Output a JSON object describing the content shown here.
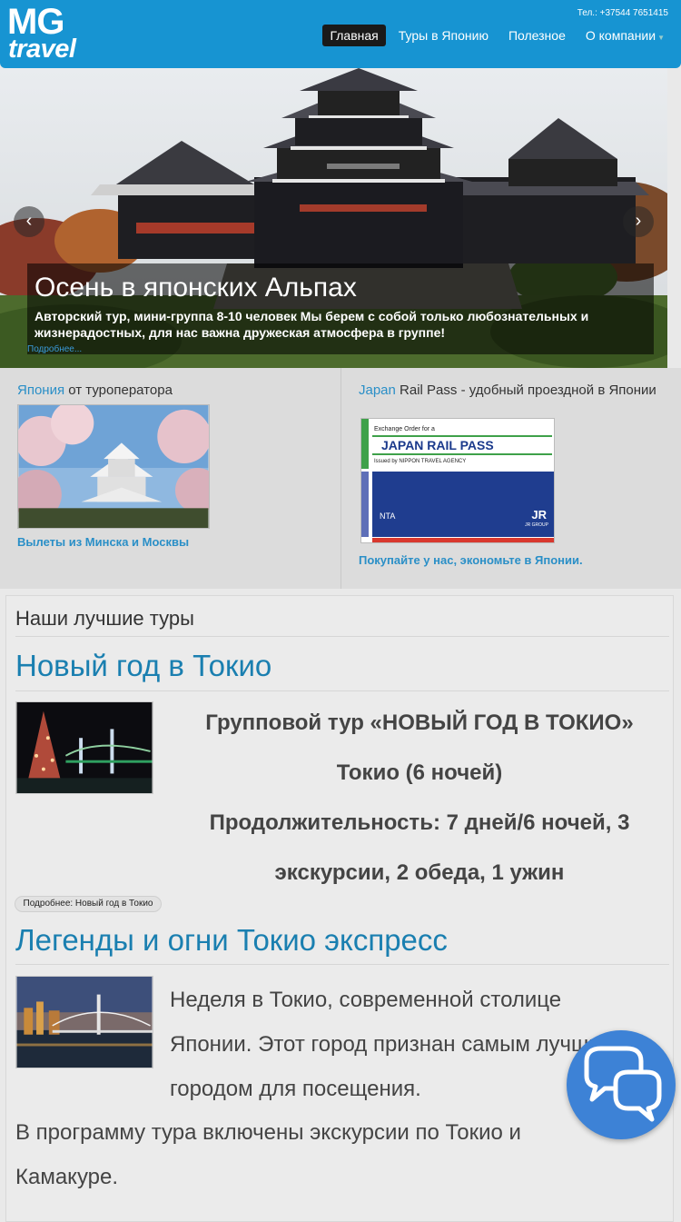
{
  "header": {
    "logo_top": "MG",
    "logo_bottom": "travel",
    "phone": "Тел.: +37544 7651415",
    "nav": [
      {
        "label": "Главная"
      },
      {
        "label": "Туры в Японию"
      },
      {
        "label": "Полезное"
      },
      {
        "label": "О компании"
      }
    ]
  },
  "hero": {
    "title": "Осень в японских Альпах",
    "text": "Авторский тур, мини-группа 8-10 человек Мы берем с собой только любознательных и жизнерадостных, для нас важна дружеская атмосфера в группе!",
    "more": "Подробнее..."
  },
  "promo": {
    "left": {
      "title_highlight": "Япония",
      "title_rest": " от туроператора",
      "link": "Вылеты из Минска и Москвы"
    },
    "right": {
      "title_highlight": "Japan",
      "title_rest": " Rail Pass - удобный проездной в Японии",
      "card_top": "Exchange Order for a",
      "card_main": "JAPAN RAIL PASS",
      "card_issuer": "Issued by  NIPPON TRAVEL AGENCY",
      "card_nta": "NTA",
      "card_jr": "JR",
      "card_jr_sub": "JR GROUP",
      "link": "Покупайте у нас, экономьте в Японии."
    }
  },
  "content": {
    "section_title": "Наши лучшие туры",
    "tour1": {
      "title": "Новый год в Токио",
      "line1": "Групповой тур «НОВЫЙ ГОД В ТОКИО»",
      "line2": "Токио (6 ночей)",
      "line3": "Продолжительность: 7 дней/6 ночей, 3 экскурсии, 2 обеда, 1 ужин",
      "more": "Подробнее: Новый год в Токио"
    },
    "tour2": {
      "title": "Легенды и огни Токио экспресс",
      "text": "Неделя в Токио, современной столице Японии. Этот город признан самым лучшим городом для посещения.",
      "text2": "В программу тура включены экскурсии по Токио и Камакуре."
    }
  },
  "colors": {
    "brand": "#1794d2",
    "link": "#2a8fc7",
    "tour_title": "#1a7fb0",
    "chat": "#3d82d6"
  }
}
